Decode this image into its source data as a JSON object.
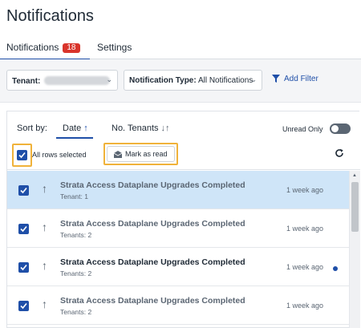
{
  "page": {
    "title": "Notifications"
  },
  "tabs": {
    "notifications_label": "Notifications",
    "notifications_count": "18",
    "settings_label": "Settings"
  },
  "filters": {
    "tenant_label": "Tenant:",
    "type_label": "Notification Type:",
    "type_value": "All Notifications",
    "add_filter_label": "Add Filter"
  },
  "sort": {
    "label": "Sort by:",
    "date_label": "Date",
    "tenants_label": "No. Tenants",
    "unread_only_label": "Unread Only",
    "unread_only_on": false
  },
  "actions": {
    "all_rows_selected_label": "All rows selected",
    "mark_as_read_label": "Mark as read"
  },
  "rows": [
    {
      "title": "Strata Access Dataplane Upgrades Completed",
      "subtitle": "Tenant: 1",
      "time": "1 week ago",
      "unread": false,
      "checked": true,
      "selected": true
    },
    {
      "title": "Strata Access Dataplane Upgrades Completed",
      "subtitle": "Tenants: 2",
      "time": "1 week ago",
      "unread": false,
      "checked": true,
      "selected": false
    },
    {
      "title": "Strata Access Dataplane Upgrades Completed",
      "subtitle": "Tenants: 2",
      "time": "1 week ago",
      "unread": true,
      "checked": true,
      "selected": false
    },
    {
      "title": "Strata Access Dataplane Upgrades Completed",
      "subtitle": "Tenants: 2",
      "time": "1 week ago",
      "unread": false,
      "checked": true,
      "selected": false
    }
  ],
  "colors": {
    "accent": "#1f4fa8",
    "badge": "#d9342b",
    "highlight": "#f0b23a",
    "selected_row": "#cfe5f8"
  }
}
